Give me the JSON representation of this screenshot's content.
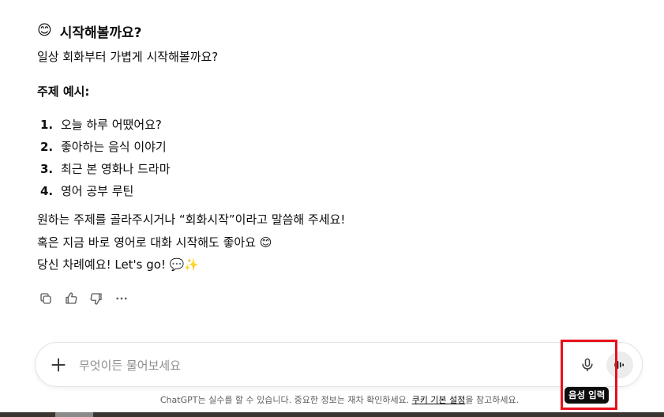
{
  "message": {
    "heading_emoji": "😊",
    "heading": "시작해볼까요?",
    "intro": "일상 회화부터 가볍게 시작해볼까요?",
    "subheading": "주제 예시:",
    "topics": [
      {
        "num": "1.",
        "text": "오늘 하루 어땠어요?"
      },
      {
        "num": "2.",
        "text": "좋아하는 음식 이야기"
      },
      {
        "num": "3.",
        "text": "최근 본 영화나 드라마"
      },
      {
        "num": "4.",
        "text": "영어 공부 루틴"
      }
    ],
    "closing": [
      "원하는 주제를 골라주시거나 “회화시작”이라고 말씀해 주세요!",
      "혹은 지금 바로 영어로 대화 시작해도 좋아요 😊",
      "당신 차례예요! Let's go! 💬✨"
    ]
  },
  "actions": {
    "copy": "copy-icon",
    "thumbs_up": "thumbs-up-icon",
    "thumbs_down": "thumbs-down-icon",
    "more": "more-icon"
  },
  "composer": {
    "placeholder": "무엇이든 물어보세요",
    "tooltip": "음성 입력"
  },
  "footer": {
    "disclaimer_prefix": "ChatGPT는 실수를 할 수 있습니다. 중요한 정보는 재차 확인하세요. ",
    "link": "쿠키 기본 설정",
    "disclaimer_suffix": "을 참고하세요."
  },
  "colors": {
    "highlight": "#e8101a",
    "tooltip_bg": "#0d0d0d",
    "voice_button_bg": "#ececec"
  }
}
